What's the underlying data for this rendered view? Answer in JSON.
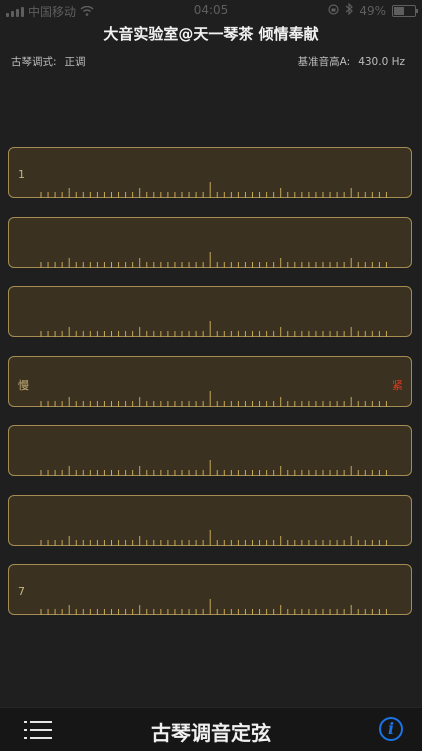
{
  "status_bar": {
    "carrier": "中国移动",
    "time": "04:05",
    "battery": "49%",
    "icons": [
      "signal-icon",
      "wifi-icon",
      "orientation-lock-icon",
      "bluetooth-icon",
      "battery-icon"
    ]
  },
  "header": {
    "title": "大音实验室@天一琴茶 倾情奉献"
  },
  "info": {
    "mode_label": "古琴调式:",
    "mode_value": "正调",
    "ref_label": "基准音高A:",
    "ref_value": "430.0 Hz"
  },
  "strings": [
    {
      "left": "1",
      "right": ""
    },
    {
      "left": "",
      "right": ""
    },
    {
      "left": "",
      "right": ""
    },
    {
      "left": "慢",
      "right": "紧"
    },
    {
      "left": "",
      "right": ""
    },
    {
      "left": "",
      "right": ""
    },
    {
      "left": "7",
      "right": ""
    }
  ],
  "bottom": {
    "title": "古琴调音定弦",
    "info_symbol": "i"
  },
  "colors": {
    "background": "#1f1f1f",
    "bar_fill": "#3b3120",
    "bar_border": "#a48d52",
    "tick": "#c7a95b",
    "warning": "#e03a22",
    "accent": "#1b74e4"
  }
}
